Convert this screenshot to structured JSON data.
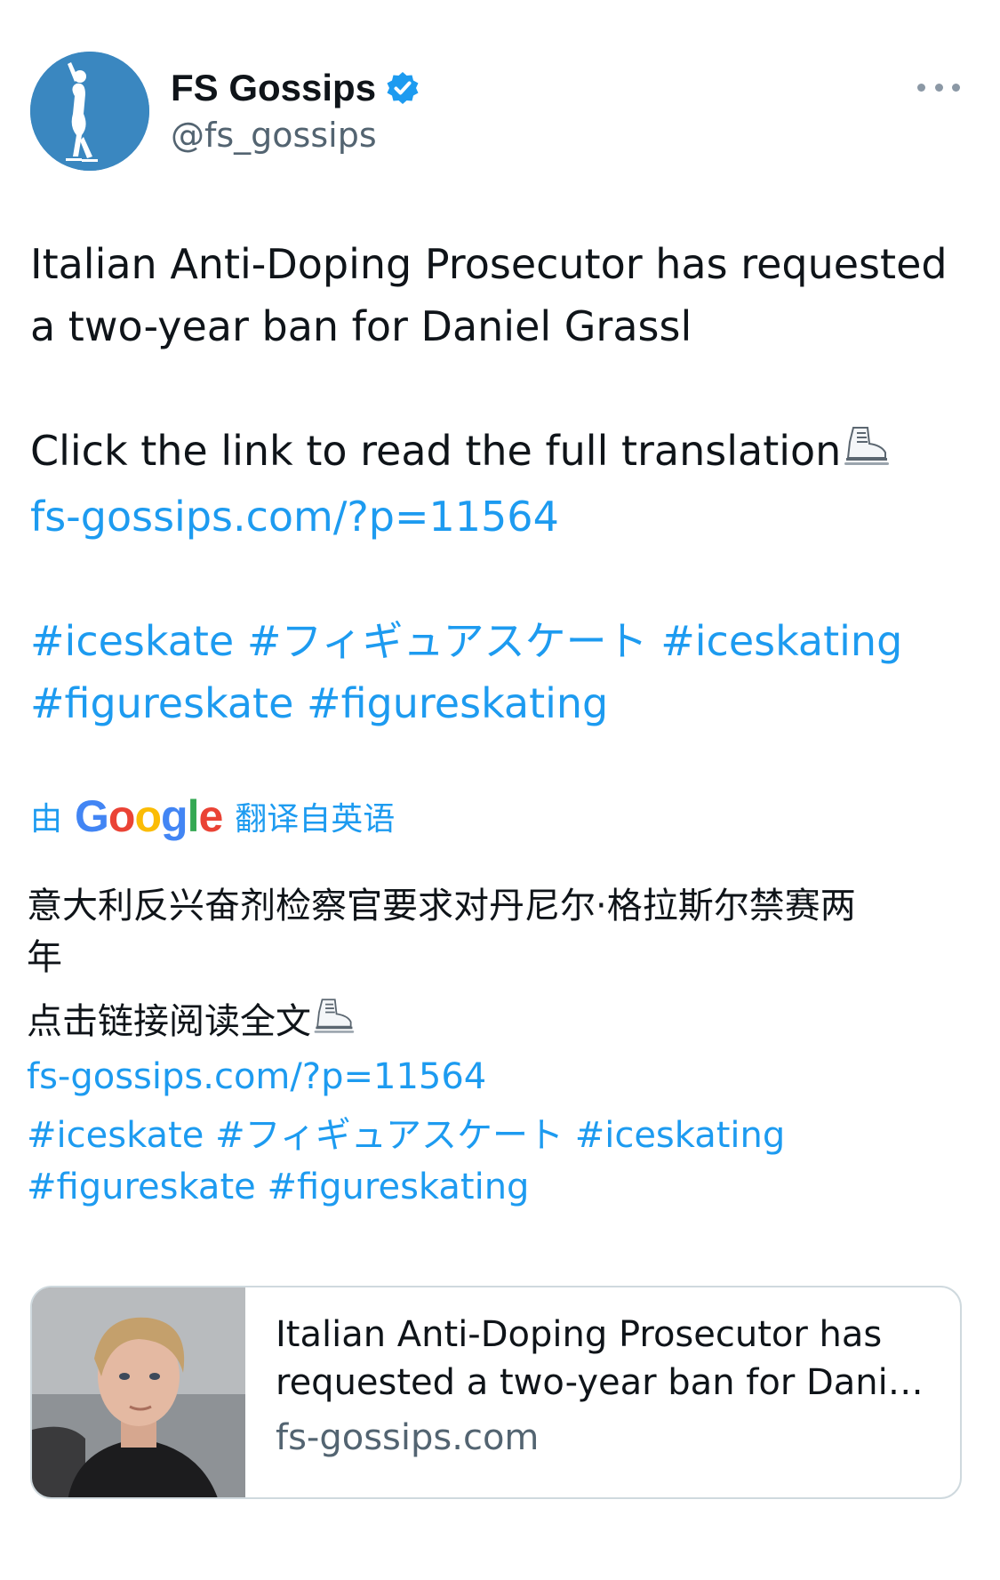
{
  "author": {
    "display_name": "FS Gossips",
    "handle": "@fs_gossips",
    "verified": true,
    "avatar_icon": "figure-skater-silhouette"
  },
  "menu": {
    "icon": "more-horizontal-icon"
  },
  "tweet": {
    "line1": "Italian Anti-Doping Prosecutor has requested",
    "line2": "a two-year ban for Daniel Grassl",
    "line3": "Click the link to read the full translation",
    "emoji": "ice-skate",
    "link": "fs-gossips.com/?p=11564",
    "hashtags_line1": [
      "#iceskate",
      "#フィギュアスケート",
      "#iceskating"
    ],
    "hashtags_line2": [
      "#figureskate",
      "#figureskating"
    ]
  },
  "translation_label": {
    "prefix": "由",
    "provider": "Google",
    "suffix": "翻译自英语"
  },
  "translation": {
    "line1": "意大利反兴奋剂检察官要求对丹尼尔·格拉斯尔禁赛两",
    "line2": "年",
    "line3": "点击链接阅读全文",
    "link": "fs-gossips.com/?p=11564",
    "hashtags_line1": [
      "#iceskate",
      "#フィギュアスケート",
      "#iceskating"
    ],
    "hashtags_line2": [
      "#figureskate",
      "#figureskating"
    ]
  },
  "card": {
    "title": "Italian Anti-Doping Prosecutor has requested a two-year ban for Daniel Grassl",
    "domain": "fs-gossips.com"
  },
  "colors": {
    "link": "#1d9bf0",
    "text": "#0f1419",
    "secondary": "#536471",
    "avatar_bg": "#3a87c0"
  }
}
